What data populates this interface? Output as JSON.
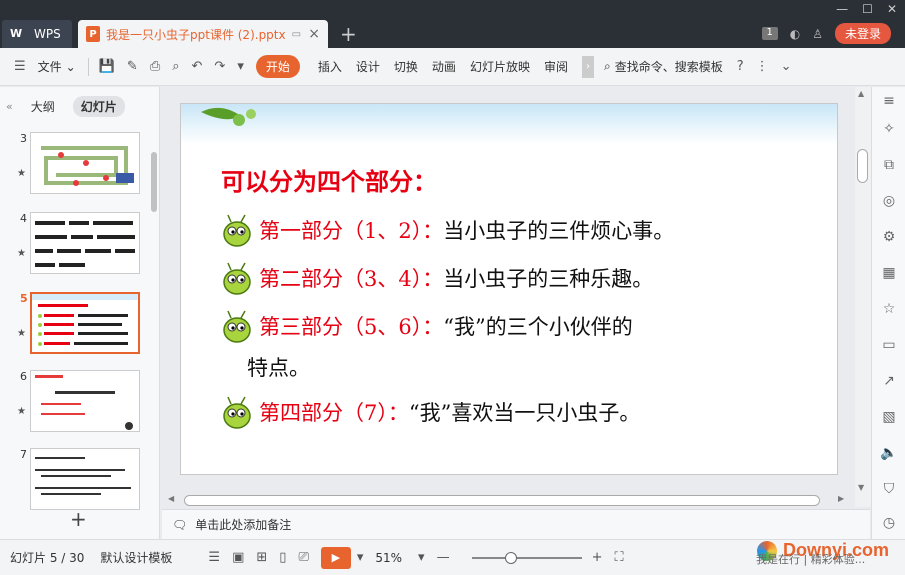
{
  "titlebar": {
    "wps_label": "WPS",
    "doc_title": "我是一只小虫子ppt课件 (2).pptx",
    "new_tab": "+",
    "badge": "1",
    "login": "未登录"
  },
  "ribbon": {
    "file_menu": "文件",
    "tabs": [
      "开始",
      "插入",
      "设计",
      "切换",
      "动画",
      "幻灯片放映",
      "审阅"
    ],
    "active_tab": "开始",
    "search": "查找命令、搜索模板",
    "help": "?"
  },
  "left_panel": {
    "tab_outline": "大纲",
    "tab_slides": "幻灯片",
    "thumbnails": [
      {
        "num": "3"
      },
      {
        "num": "4"
      },
      {
        "num": "5"
      },
      {
        "num": "6"
      },
      {
        "num": "7"
      }
    ],
    "add": "+"
  },
  "slide": {
    "heading": "可以分为四个部分：",
    "parts": [
      {
        "label": "第一部分（1、2）：",
        "text": "当小虫子的三件烦心事。"
      },
      {
        "label": "第二部分（3、4）：",
        "text": "当小虫子的三种乐趣。"
      },
      {
        "label": "第三部分（5、6）：",
        "text": "“我”的三个小伙伴的",
        "cont": "特点。"
      },
      {
        "label": "第四部分（7）：",
        "text": "“我”喜欢当一只小虫子。"
      }
    ]
  },
  "notes": {
    "placeholder": "单击此处添加备注"
  },
  "statusbar": {
    "slide_count": "幻灯片 5 / 30",
    "template": "默认设计模板",
    "zoom": "51%",
    "watermark": "Downyi.com",
    "watermark_sub": "我是在行 | 精彩体验..."
  },
  "colors": {
    "accent": "#e8642e",
    "heading_red": "#e60012"
  }
}
